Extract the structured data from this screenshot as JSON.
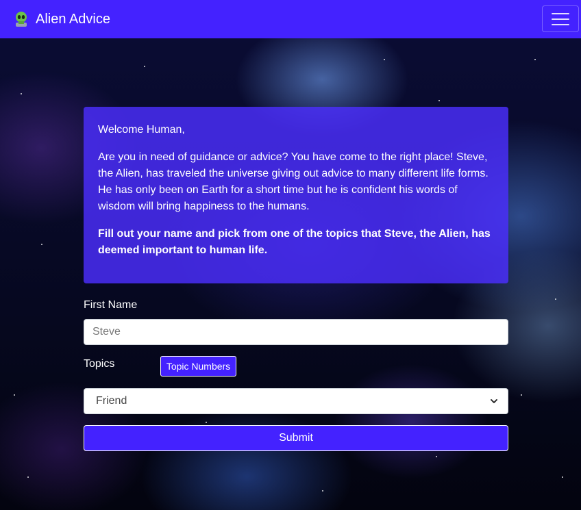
{
  "navbar": {
    "brand": "Alien Advice",
    "brand_icon": "alien-icon",
    "menu_icon": "hamburger-menu-icon",
    "background_color": "#4422ff"
  },
  "intro": {
    "greeting": "Welcome Human,",
    "body": "Are you in need of guidance or advice? You have come to the right place! Steve, the Alien, has traveled the universe giving out advice to many different life forms. He has only been on Earth for a short time but he is confident his words of wisdom will bring happiness to the humans.",
    "instruction": "Fill out your name and pick from one of the topics that Steve, the Alien, has deemed important to human life."
  },
  "form": {
    "first_name_label": "First Name",
    "first_name_placeholder": "Steve",
    "topics_label": "Topics",
    "topic_numbers_button": "Topic Numbers",
    "topic_selected": "Friend",
    "submit_label": "Submit"
  }
}
